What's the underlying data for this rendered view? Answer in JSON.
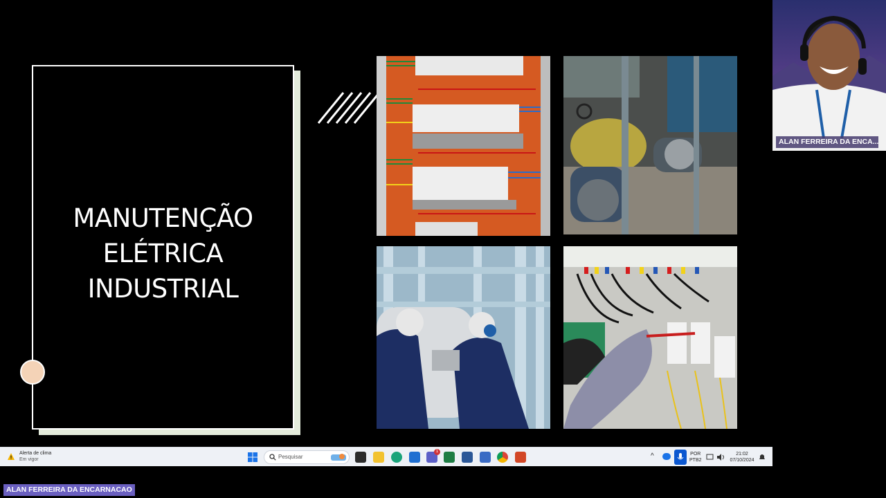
{
  "slide": {
    "title_lines": [
      "MANUTENÇÃO",
      "ELÉTRICA",
      "INDUSTRIAL"
    ],
    "accent_colors": {
      "circle": "#f4d3b7",
      "frame_shadow": "#e4ecdc"
    },
    "images": [
      "electrical-panel-photo",
      "industrial-motors-photo",
      "workers-plant-photo",
      "technician-multimeter-photo"
    ]
  },
  "webcam": {
    "participant_name": "ALAN FERREIRA DA ENCA..."
  },
  "taskbar": {
    "weather_title": "Alerta de clima",
    "weather_status": "Em vigor",
    "search_placeholder": "Pesquisar",
    "language_line1": "POR",
    "language_line2": "PTB2",
    "time": "21:02",
    "date": "07/10/2024",
    "teams_badge": "1",
    "tray_chevron": "^"
  },
  "presenter_label": "ALAN FERREIRA DA ENCARNACAO"
}
